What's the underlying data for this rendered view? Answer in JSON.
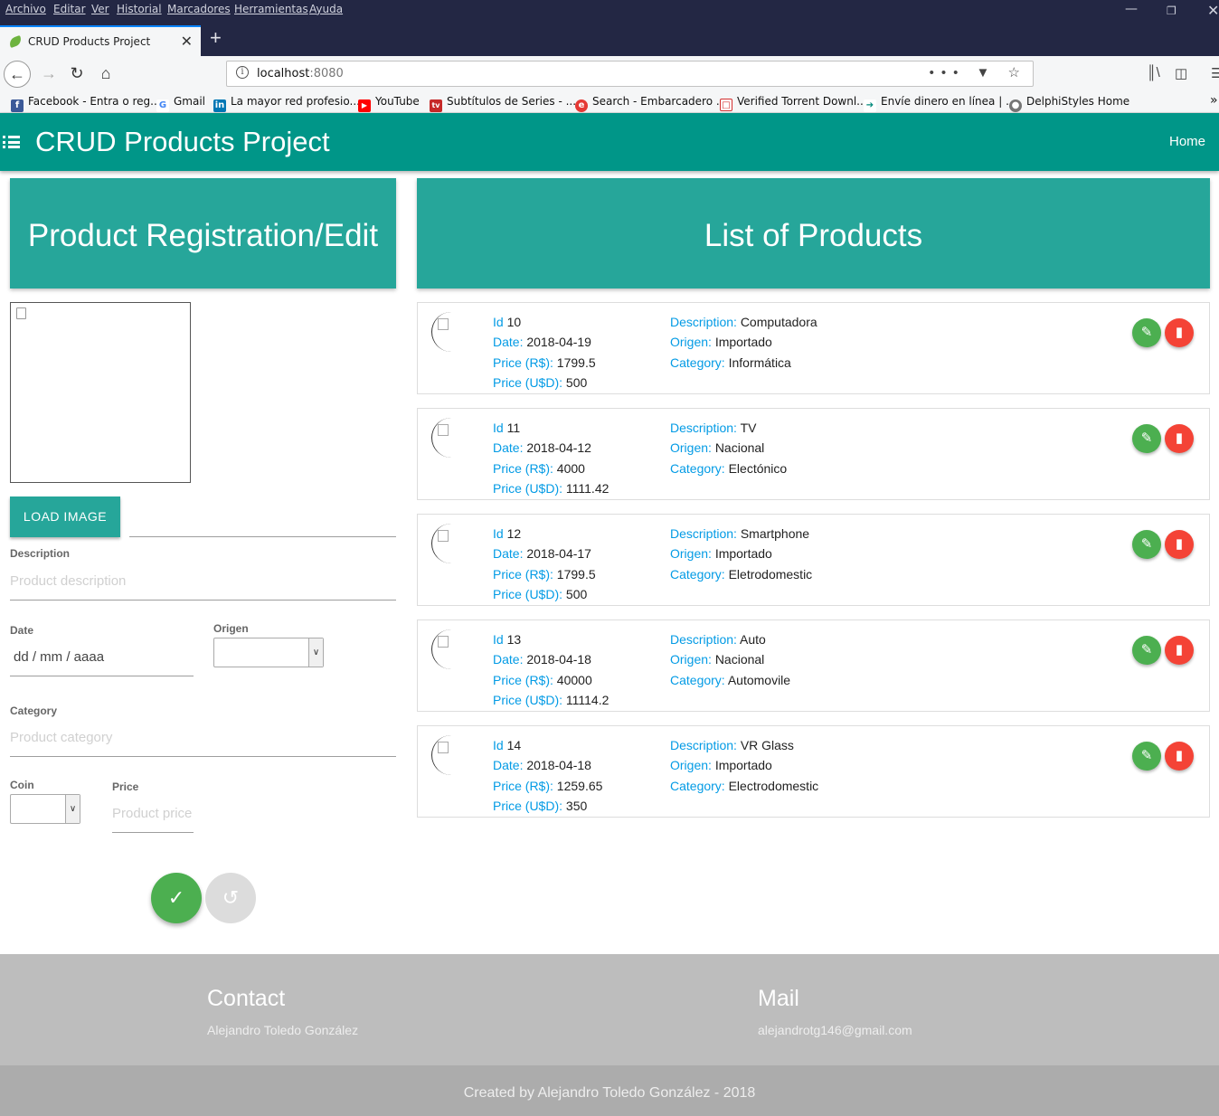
{
  "browser": {
    "menu": [
      "Archivo",
      "Editar",
      "Ver",
      "Historial",
      "Marcadores",
      "Herramientas",
      "Ayuda"
    ],
    "tab_title": "CRUD Products Project",
    "url_host": "localhost",
    "url_port": ":8080",
    "bookmarks": [
      {
        "label": "Facebook - Entra o reg...",
        "icon": "facebook-icon",
        "color": "#3b5998"
      },
      {
        "label": "Gmail",
        "icon": "google-icon",
        "color": "#4285f4"
      },
      {
        "label": "La mayor red profesio...",
        "icon": "linkedin-icon",
        "color": "#0077b5"
      },
      {
        "label": "YouTube",
        "icon": "youtube-icon",
        "color": "#ff0000"
      },
      {
        "label": "Subtítulos de Series - ...",
        "icon": "tv-icon",
        "color": "#c62828"
      },
      {
        "label": "Search - Embarcadero ...",
        "icon": "embarcadero-icon",
        "color": "#e53935"
      },
      {
        "label": "Verified Torrent Downl...",
        "icon": "torrent-icon",
        "color": "#d32f2f"
      },
      {
        "label": "Envíe dinero en línea | ...",
        "icon": "money-transfer-icon",
        "color": "#00897b"
      },
      {
        "label": "DelphiStyles Home",
        "icon": "globe-icon",
        "color": "#757575"
      }
    ]
  },
  "app": {
    "title": "CRUD Products Project",
    "nav_home": "Home",
    "accent": "#009688"
  },
  "form": {
    "heading": "Product Registration/Edit",
    "load_image": "LOAD IMAGE",
    "description_label": "Description",
    "description_placeholder": "Product description",
    "date_label": "Date",
    "date_value": "dd / mm / aaaa",
    "origen_label": "Origen",
    "category_label": "Category",
    "category_placeholder": "Product category",
    "coin_label": "Coin",
    "price_label": "Price",
    "price_placeholder": "Product price"
  },
  "list": {
    "heading": "List of Products",
    "labels": {
      "id": "Id",
      "date": "Date:",
      "price_rs": "Price (R$):",
      "price_usd": "Price (U$D):",
      "description": "Description:",
      "origen": "Origen:",
      "category": "Category:"
    },
    "products": [
      {
        "id": "10",
        "date": "2018-04-19",
        "price_rs": "1799.5",
        "price_usd": "500",
        "description": "Computadora",
        "origen": "Importado",
        "category": "Informática"
      },
      {
        "id": "11",
        "date": "2018-04-12",
        "price_rs": "4000",
        "price_usd": "1111.42",
        "description": "TV",
        "origen": "Nacional",
        "category": "Electónico"
      },
      {
        "id": "12",
        "date": "2018-04-17",
        "price_rs": "1799.5",
        "price_usd": "500",
        "description": "Smartphone",
        "origen": "Importado",
        "category": "Eletrodomestic"
      },
      {
        "id": "13",
        "date": "2018-04-18",
        "price_rs": "40000",
        "price_usd": "11114.2",
        "description": "Auto",
        "origen": "Nacional",
        "category": "Automovile"
      },
      {
        "id": "14",
        "date": "2018-04-18",
        "price_rs": "1259.65",
        "price_usd": "350",
        "description": "VR Glass",
        "origen": "Importado",
        "category": "Electrodomestic"
      }
    ]
  },
  "footer": {
    "contact_title": "Contact",
    "contact_name": "Alejandro Toledo González",
    "mail_title": "Mail",
    "mail_value": "alejandrotg146@gmail.com",
    "copyright": "Created by Alejandro Toledo González - 2018"
  }
}
